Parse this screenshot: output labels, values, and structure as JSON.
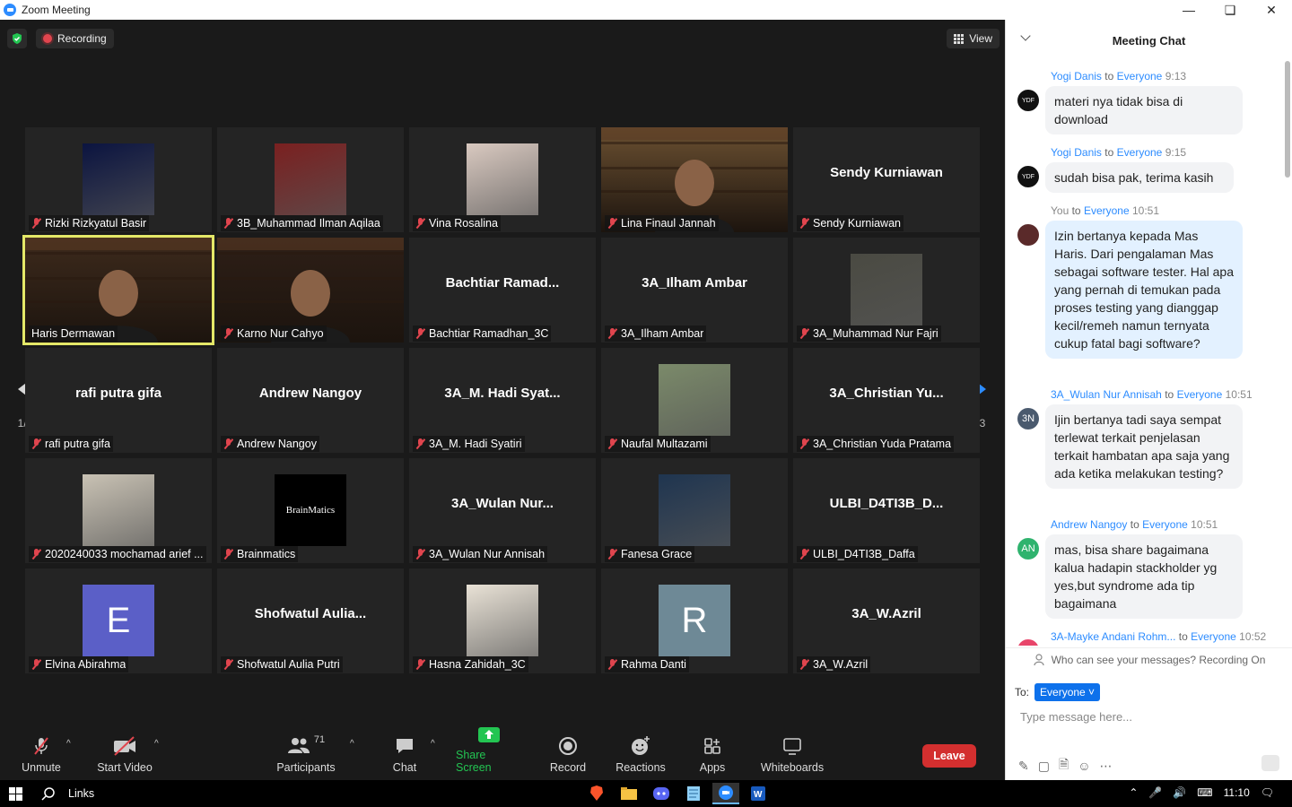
{
  "window": {
    "title": "Zoom Meeting",
    "controls": [
      "minimize",
      "maximize",
      "close"
    ]
  },
  "topbar": {
    "recording_label": "Recording",
    "view_label": "View"
  },
  "tiles": [
    {
      "name": "Rizki Rizkyatul Basir",
      "display": "",
      "kind": "photo",
      "color": "#0b1440"
    },
    {
      "name": "3B_Muhammad Ilman Aqilaa",
      "display": "",
      "kind": "photo",
      "color": "#7a2020"
    },
    {
      "name": "Vina Rosalina",
      "display": "",
      "kind": "photo",
      "color": "#d9c9c0"
    },
    {
      "name": "Lina Finaul Jannah",
      "display": "",
      "kind": "video",
      "color": "#6b5031"
    },
    {
      "name": "Sendy Kurniawan",
      "display": "Sendy Kurniawan",
      "kind": "text",
      "color": ""
    },
    {
      "name": "Haris Dermawan",
      "display": "",
      "kind": "video",
      "color": "#3d2a1c",
      "active": true,
      "muted": false
    },
    {
      "name": "Karno Nur Cahyo",
      "display": "",
      "kind": "video",
      "color": "#2e1f17"
    },
    {
      "name": "Bachtiar Ramadhan_3C",
      "display": "Bachtiar  Ramad...",
      "kind": "text",
      "color": ""
    },
    {
      "name": "3A_Ilham Ambar",
      "display": "3A_Ilham Ambar",
      "kind": "text",
      "color": ""
    },
    {
      "name": "3A_Muhammad Nur Fajri",
      "display": "",
      "kind": "photo",
      "color": "#4a4a42"
    },
    {
      "name": "rafi putra gifa",
      "display": "rafi putra gifa",
      "kind": "text",
      "color": ""
    },
    {
      "name": "Andrew Nangoy",
      "display": "Andrew Nangoy",
      "kind": "text",
      "color": ""
    },
    {
      "name": "3A_M. Hadi Syatiri",
      "display": "3A_M.  Hadi Syat...",
      "kind": "text",
      "color": ""
    },
    {
      "name": "Naufal Multazami",
      "display": "",
      "kind": "photo",
      "color": "#7b8a6a"
    },
    {
      "name": "3A_Christian Yuda Pratama",
      "display": "3A_Christian  Yu...",
      "kind": "text",
      "color": ""
    },
    {
      "name": "2020240033 mochamad arief ...",
      "display": "",
      "kind": "photo",
      "color": "#c9c2b4"
    },
    {
      "name": "Brainmatics",
      "display": "",
      "kind": "logo",
      "color": "#000000"
    },
    {
      "name": "3A_Wulan Nur Annisah",
      "display": "3A_Wulan  Nur...",
      "kind": "text",
      "color": ""
    },
    {
      "name": "Fanesa Grace",
      "display": "",
      "kind": "photo",
      "color": "#1f3550"
    },
    {
      "name": "ULBI_D4TI3B_Daffa",
      "display": "ULBI_D4TI3B_D...",
      "kind": "text",
      "color": ""
    },
    {
      "name": "Elvina Abirahma",
      "display": "",
      "kind": "letter",
      "letter": "E",
      "color": "#5b5fc7"
    },
    {
      "name": "Shofwatul Aulia Putri",
      "display": "Shofwatul  Aulia...",
      "kind": "text",
      "color": ""
    },
    {
      "name": "Hasna Zahidah_3C",
      "display": "",
      "kind": "photo",
      "color": "#e9e2d6"
    },
    {
      "name": "Rahma Danti",
      "display": "",
      "kind": "letter",
      "letter": "R",
      "color": "#6e8996"
    },
    {
      "name": "3A_W.Azril",
      "display": "3A_W.Azril",
      "kind": "text",
      "color": ""
    }
  ],
  "brainmatics_logo_text": "BrainMatics",
  "pager": {
    "left_page": "1/3",
    "right_page": "1/3"
  },
  "toolbar": {
    "unmute": "Unmute",
    "start_video": "Start Video",
    "participants": "Participants",
    "participants_count": "71",
    "chat": "Chat",
    "share_screen": "Share Screen",
    "record": "Record",
    "reactions": "Reactions",
    "apps": "Apps",
    "whiteboards": "Whiteboards",
    "leave": "Leave"
  },
  "chat": {
    "title": "Meeting Chat",
    "to_word": "to",
    "messages": [
      {
        "sender": "Yogi Danis",
        "recipient": "Everyone",
        "time": "9:13",
        "avatar": "YDF",
        "avatar_color": "#111111",
        "text": "materi nya tidak bisa di download",
        "mine": false
      },
      {
        "sender": "Yogi Danis",
        "recipient": "Everyone",
        "time": "9:15",
        "avatar": "YDF",
        "avatar_color": "#111111",
        "text": "sudah bisa pak, terima kasih",
        "mine": false
      },
      {
        "sender": "You",
        "recipient": "Everyone",
        "time": "10:51",
        "avatar": "",
        "avatar_color": "#5a2a2a",
        "text": "Izin bertanya kepada Mas Haris. Dari pengalaman Mas sebagai software tester. Hal apa yang pernah di temukan pada proses testing yang dianggap kecil/remeh namun ternyata cukup fatal bagi software?",
        "mine": true
      },
      {
        "sender": "3A_Wulan Nur Annisah",
        "recipient": "Everyone",
        "time": "10:51",
        "avatar": "3N",
        "avatar_color": "#4a5a6e",
        "text": "Ijin bertanya tadi saya sempat terlewat terkait penjelasan terkait hambatan apa saja yang ada ketika melakukan testing?",
        "mine": false
      },
      {
        "sender": "Andrew Nangoy",
        "recipient": "Everyone",
        "time": "10:51",
        "avatar": "AN",
        "avatar_color": "#2fb36e",
        "text": "mas, bisa share bagaimana kalua hadapin stackholder yg yes,but syndrome ada tip bagaimana",
        "mine": false
      },
      {
        "sender": "3A-Mayke Andani Rohm...",
        "recipient": "Everyone",
        "time": "10:52",
        "avatar": "",
        "avatar_color": "#e8456a",
        "text": "",
        "mine": false
      }
    ],
    "privacy_note": "Who can see your messages? Recording On",
    "to_label": "To:",
    "to_value": "Everyone",
    "input_placeholder": "Type message here..."
  },
  "taskbar": {
    "search_label": "Links",
    "time": "11:10"
  }
}
